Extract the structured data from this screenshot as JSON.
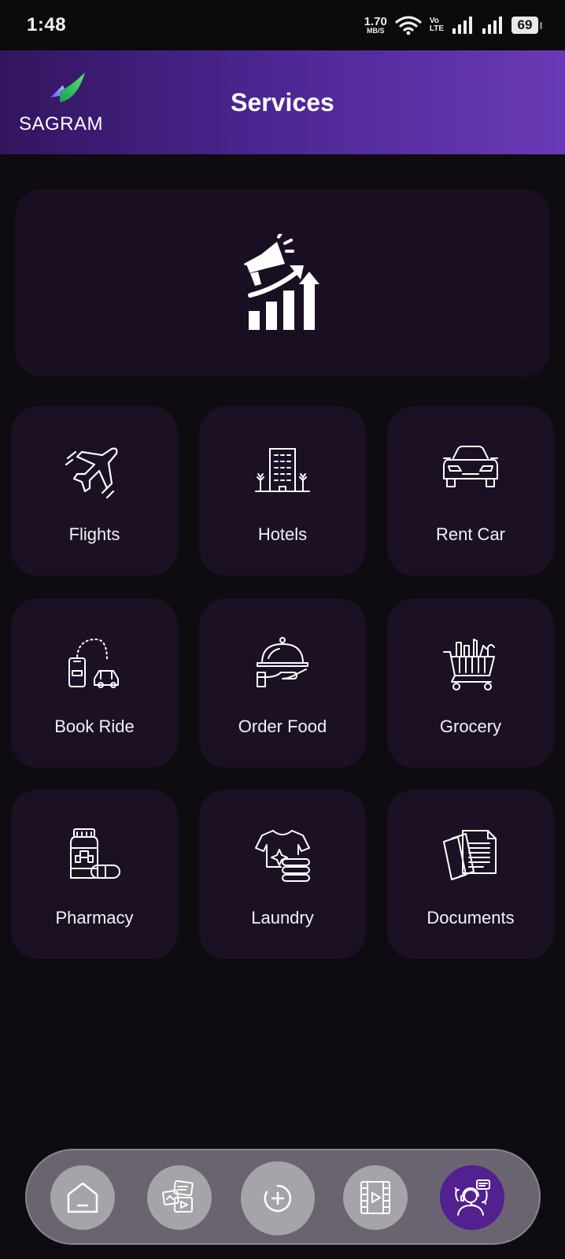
{
  "status_bar": {
    "time": "1:48",
    "net_speed_value": "1.70",
    "net_speed_unit": "MB/S",
    "volte_top": "Vo",
    "volte_bottom": "LTE",
    "battery": "69"
  },
  "header": {
    "logo_text": "SAGRAM",
    "title": "Services"
  },
  "banner": {
    "icon": "marketing-growth-icon"
  },
  "services": [
    {
      "label": "Flights",
      "icon": "airplane-icon"
    },
    {
      "label": "Hotels",
      "icon": "hotel-building-icon"
    },
    {
      "label": "Rent Car",
      "icon": "car-icon"
    },
    {
      "label": "Book Ride",
      "icon": "ride-booking-icon"
    },
    {
      "label": "Order Food",
      "icon": "food-cloche-icon"
    },
    {
      "label": "Grocery",
      "icon": "shopping-cart-icon"
    },
    {
      "label": "Pharmacy",
      "icon": "medicine-bottle-icon"
    },
    {
      "label": "Laundry",
      "icon": "laundry-shirt-icon"
    },
    {
      "label": "Documents",
      "icon": "documents-icon"
    }
  ],
  "bottom_nav": [
    {
      "icon": "home-icon"
    },
    {
      "icon": "media-gallery-icon"
    },
    {
      "icon": "add-circle-icon"
    },
    {
      "icon": "video-film-icon"
    },
    {
      "icon": "support-agent-icon",
      "active": true
    }
  ],
  "colors": {
    "header_gradient_start": "#33155f",
    "header_gradient_end": "#6a3ab6",
    "tile_background": "#1b1024",
    "page_background": "#0e0c10",
    "active_nav": "#52208f"
  }
}
